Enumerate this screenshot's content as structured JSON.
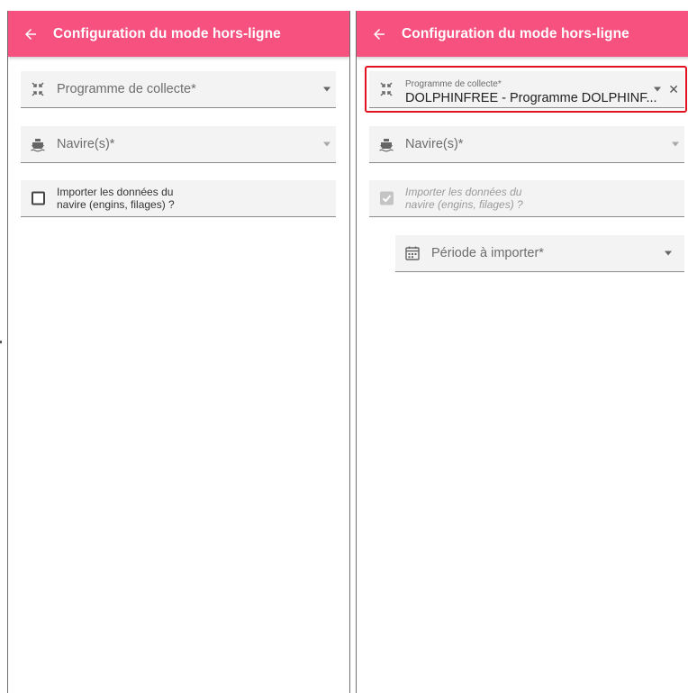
{
  "toolbar": {
    "title": "Configuration du mode hors-ligne"
  },
  "left": {
    "program_field": {
      "label": "Programme de collecte*"
    },
    "vessel_field": {
      "label": "Navire(s)*"
    },
    "import_checkbox": {
      "line1": "Importer les données du",
      "line2": "navire (engins, filages) ?",
      "checked": false
    }
  },
  "right": {
    "program_field": {
      "floating_label": "Programme de collecte*",
      "value": "DOLPHINFREE - Programme DOLPHINF..."
    },
    "vessel_field": {
      "label": "Navire(s)*"
    },
    "import_checkbox": {
      "line1": "Importer les données du",
      "line2": "navire (engins, filages) ?",
      "checked": true,
      "disabled": true
    },
    "period_field": {
      "label": "Période à importer*"
    }
  },
  "colors": {
    "toolbar": "#f7517f",
    "highlight": "#e0141e",
    "field_bg": "#f3f3f3"
  },
  "icons": {
    "back": "arrow-back-icon",
    "program": "compress-icon",
    "vessel": "boat-icon",
    "period": "calendar-icon",
    "clear": "close-icon"
  }
}
